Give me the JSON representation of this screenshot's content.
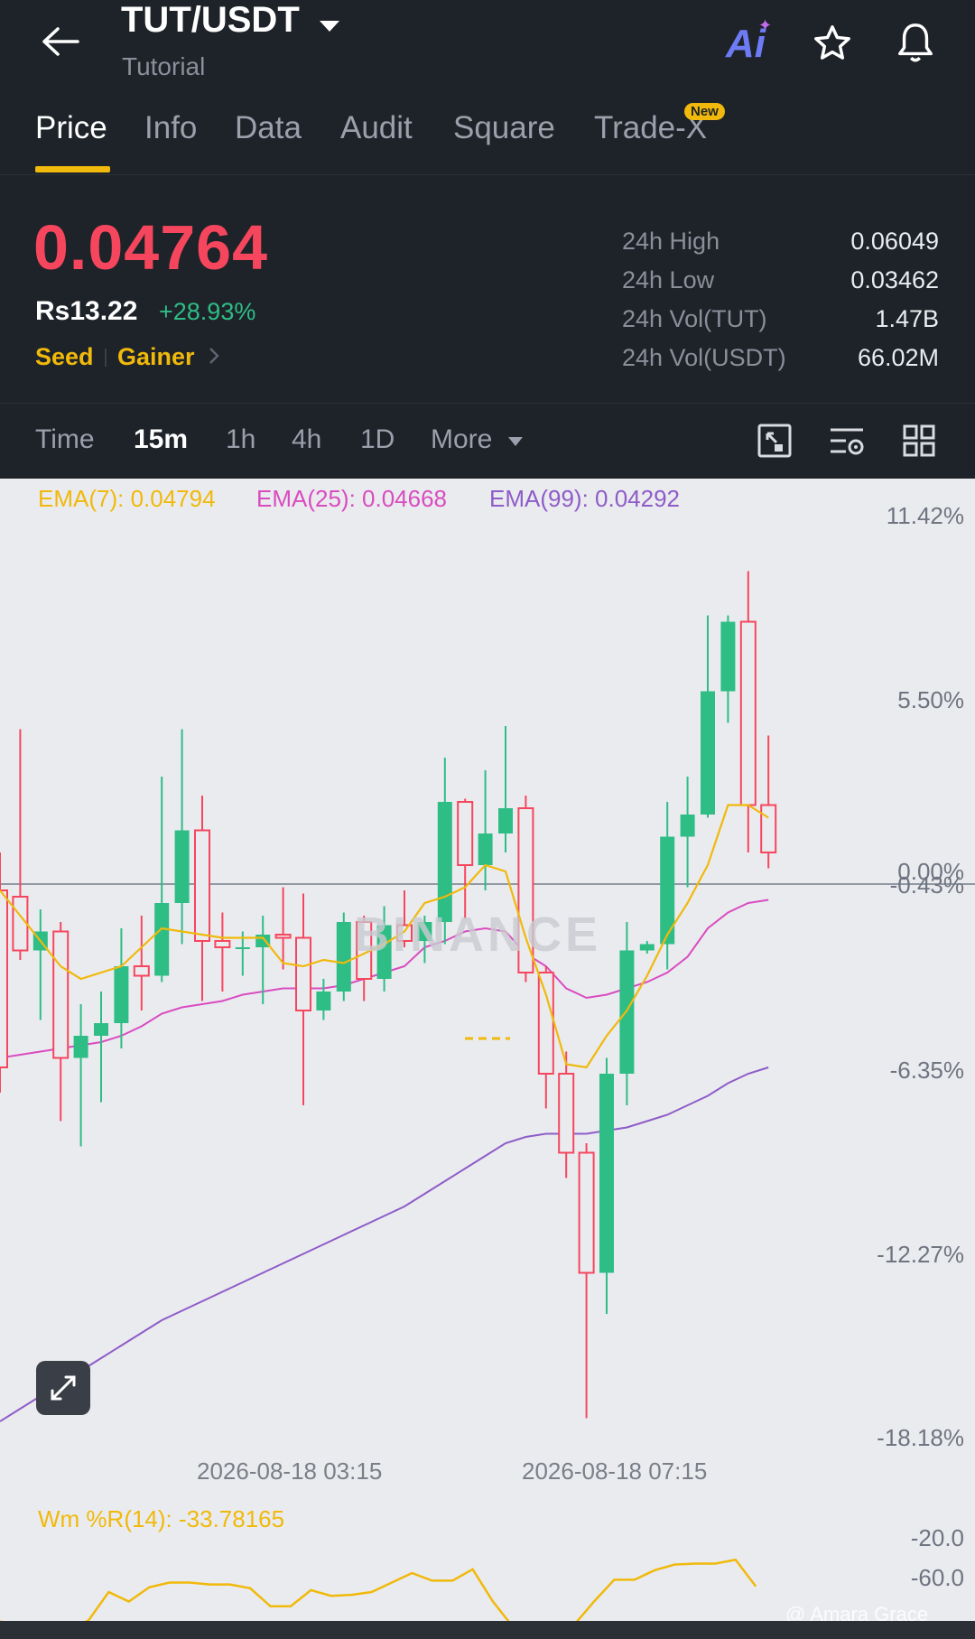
{
  "header": {
    "pair": "TUT/USDT",
    "subtitle": "Tutorial",
    "ai_label": "Ai"
  },
  "tabs": [
    {
      "label": "Price",
      "active": true
    },
    {
      "label": "Info",
      "active": false
    },
    {
      "label": "Data",
      "active": false
    },
    {
      "label": "Audit",
      "active": false
    },
    {
      "label": "Square",
      "active": false
    },
    {
      "label": "Trade-X",
      "active": false,
      "badge": "New"
    }
  ],
  "price": {
    "last": "0.04764",
    "fiat": "Rs13.22",
    "change": "+28.93%",
    "tag1": "Seed",
    "tag2": "Gainer"
  },
  "stats": [
    {
      "label": "24h High",
      "value": "0.06049"
    },
    {
      "label": "24h Low",
      "value": "0.03462"
    },
    {
      "label": "24h Vol(TUT)",
      "value": "1.47B"
    },
    {
      "label": "24h Vol(USDT)",
      "value": "66.02M"
    }
  ],
  "intervals": [
    {
      "label": "Time",
      "active": false
    },
    {
      "label": "15m",
      "active": true
    },
    {
      "label": "1h",
      "active": false
    },
    {
      "label": "4h",
      "active": false
    },
    {
      "label": "1D",
      "active": false
    },
    {
      "label": "More",
      "active": false
    }
  ],
  "indicators": {
    "ema7": "EMA(7): 0.04794",
    "ema25": "EMA(25): 0.04668",
    "ema99": "EMA(99): 0.04292",
    "wr": "Wm %R(14): -33.78165"
  },
  "watermark": "BINANCE",
  "credit": "@ Amara Grace",
  "colors": {
    "up": "#2ebd85",
    "down": "#f6465d",
    "accent": "#f0b90b",
    "ema7": "#f0b90b",
    "ema25": "#d94cc0",
    "ema99": "#8e5cc8",
    "background_dark": "#1e2329",
    "chart_bg": "#eaebef"
  },
  "chart_data": {
    "type": "candlestick",
    "y_unit": "% change",
    "y_ticks": [
      "11.42%",
      "5.50%",
      "0.00%",
      "-0.43%",
      "-6.35%",
      "-12.27%",
      "-18.18%"
    ],
    "x_ticks": [
      "2026-08-18 03:15",
      "2026-08-18 07:15"
    ],
    "ylim": [
      -18.18,
      11.42
    ],
    "candles": [
      {
        "o": -0.2,
        "h": 1.0,
        "l": -6.6,
        "c": -5.8
      },
      {
        "o": -0.4,
        "h": 4.9,
        "l": -2.4,
        "c": -2.1
      },
      {
        "o": -2.1,
        "h": -0.8,
        "l": -4.3,
        "c": -1.5
      },
      {
        "o": -1.5,
        "h": -1.2,
        "l": -7.5,
        "c": -5.5
      },
      {
        "o": -5.5,
        "h": -3.8,
        "l": -8.3,
        "c": -4.8
      },
      {
        "o": -4.8,
        "h": -3.4,
        "l": -6.9,
        "c": -4.4
      },
      {
        "o": -4.4,
        "h": -1.4,
        "l": -5.2,
        "c": -2.6
      },
      {
        "o": -2.6,
        "h": -1.0,
        "l": -4.0,
        "c": -2.9
      },
      {
        "o": -2.9,
        "h": 3.4,
        "l": -3.1,
        "c": -0.6
      },
      {
        "o": -0.6,
        "h": 4.9,
        "l": -1.9,
        "c": 1.7
      },
      {
        "o": 1.7,
        "h": 2.8,
        "l": -3.7,
        "c": -1.8
      },
      {
        "o": -1.8,
        "h": -0.9,
        "l": -3.4,
        "c": -2.0
      },
      {
        "o": -2.0,
        "h": -1.5,
        "l": -2.9,
        "c": -2.0
      },
      {
        "o": -2.0,
        "h": -1.0,
        "l": -3.8,
        "c": -1.6
      },
      {
        "o": -1.6,
        "h": -0.1,
        "l": -2.7,
        "c": -1.7
      },
      {
        "o": -1.7,
        "h": -0.3,
        "l": -7.0,
        "c": -4.0
      },
      {
        "o": -4.0,
        "h": -3.0,
        "l": -4.3,
        "c": -3.4
      },
      {
        "o": -3.4,
        "h": -0.9,
        "l": -3.7,
        "c": -1.2
      },
      {
        "o": -1.2,
        "h": -1.0,
        "l": -3.7,
        "c": -3.0
      },
      {
        "o": -3.0,
        "h": -0.7,
        "l": -3.4,
        "c": -1.3
      },
      {
        "o": -1.3,
        "h": -0.2,
        "l": -2.0,
        "c": -1.8
      },
      {
        "o": -1.8,
        "h": -1.0,
        "l": -2.5,
        "c": -1.2
      },
      {
        "o": -1.2,
        "h": 4.0,
        "l": -1.9,
        "c": 2.6
      },
      {
        "o": 2.6,
        "h": 2.7,
        "l": -1.1,
        "c": 0.6
      },
      {
        "o": 0.6,
        "h": 3.6,
        "l": -0.2,
        "c": 1.6
      },
      {
        "o": 1.6,
        "h": 5.0,
        "l": 1.0,
        "c": 2.4
      },
      {
        "o": 2.4,
        "h": 2.8,
        "l": -3.1,
        "c": -2.8
      },
      {
        "o": -2.8,
        "h": -2.6,
        "l": -7.1,
        "c": -6.0
      },
      {
        "o": -6.0,
        "h": -5.3,
        "l": -9.3,
        "c": -8.5
      },
      {
        "o": -8.5,
        "h": -8.2,
        "l": -16.9,
        "c": -12.3
      },
      {
        "o": -12.3,
        "h": -5.5,
        "l": -13.6,
        "c": -6.0
      },
      {
        "o": -6.0,
        "h": -1.2,
        "l": -7.0,
        "c": -2.1
      },
      {
        "o": -2.1,
        "h": -1.8,
        "l": -2.2,
        "c": -1.9
      },
      {
        "o": -1.9,
        "h": 2.6,
        "l": -2.7,
        "c": 1.5
      },
      {
        "o": 1.5,
        "h": 3.4,
        "l": -0.1,
        "c": 2.2
      },
      {
        "o": 2.2,
        "h": 8.5,
        "l": 2.1,
        "c": 6.1
      },
      {
        "o": 6.1,
        "h": 8.5,
        "l": 5.1,
        "c": 8.3
      },
      {
        "o": 8.3,
        "h": 9.9,
        "l": 1.0,
        "c": 2.5
      },
      {
        "o": 2.5,
        "h": 4.7,
        "l": 0.5,
        "c": 1.0
      }
    ],
    "ema7": [
      -0.2,
      -1.0,
      -1.8,
      -2.6,
      -3.0,
      -2.8,
      -2.6,
      -2.0,
      -1.4,
      -1.5,
      -1.6,
      -1.7,
      -1.7,
      -1.7,
      -2.5,
      -2.6,
      -2.4,
      -2.5,
      -2.2,
      -1.9,
      -1.5,
      -0.6,
      -0.4,
      -0.1,
      0.6,
      0.4,
      -1.7,
      -3.5,
      -5.7,
      -5.8,
      -4.8,
      -4.0,
      -2.9,
      -1.6,
      -0.6,
      0.6,
      2.5,
      2.5,
      2.1
    ],
    "ema25": [
      -5.5,
      -5.4,
      -5.3,
      -5.2,
      -5.1,
      -5.0,
      -4.8,
      -4.5,
      -4.1,
      -3.9,
      -3.8,
      -3.7,
      -3.5,
      -3.4,
      -3.3,
      -3.3,
      -3.3,
      -3.2,
      -3.0,
      -2.8,
      -2.6,
      -2.0,
      -1.8,
      -1.5,
      -1.4,
      -1.5,
      -2.2,
      -2.6,
      -3.3,
      -3.6,
      -3.5,
      -3.3,
      -3.1,
      -2.8,
      -2.3,
      -1.4,
      -0.9,
      -0.6,
      -0.5
    ],
    "ema99": [
      -17.0,
      -16.6,
      -16.2,
      -15.8,
      -15.4,
      -15.0,
      -14.6,
      -14.2,
      -13.8,
      -13.5,
      -13.2,
      -12.9,
      -12.6,
      -12.3,
      -12.0,
      -11.7,
      -11.4,
      -11.1,
      -10.8,
      -10.5,
      -10.2,
      -9.8,
      -9.4,
      -9.0,
      -8.6,
      -8.2,
      -8.0,
      -7.9,
      -7.9,
      -7.9,
      -7.8,
      -7.7,
      -7.5,
      -7.3,
      -7.0,
      -6.7,
      -6.3,
      -6.0,
      -5.8
    ],
    "wr_ticks": [
      "-20.0",
      "-60.0"
    ],
    "wr_values": [
      -90,
      -92,
      -99,
      -99,
      -99,
      -90,
      -60,
      -70,
      -55,
      -50,
      -50,
      -52,
      -52,
      -56,
      -75,
      -75,
      -58,
      -64,
      -63,
      -60,
      -50,
      -40,
      -48,
      -48,
      -36,
      -70,
      -97,
      -99,
      -99,
      -95,
      -70,
      -47,
      -47,
      -37,
      -31,
      -30,
      -30,
      -26,
      -54
    ]
  }
}
